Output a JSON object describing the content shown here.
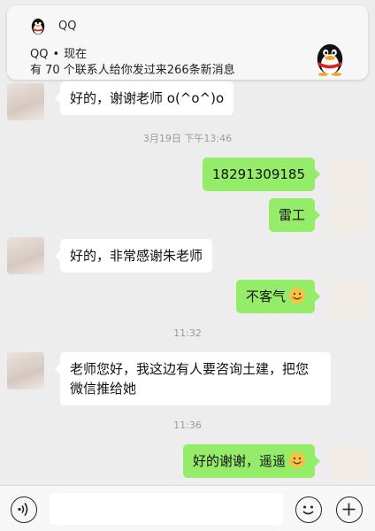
{
  "notification": {
    "app_name": "QQ",
    "sender": "QQ",
    "time": "现在",
    "message": "有 70 个联系人给你发过来266条新消息",
    "icon": "qq-penguin-icon"
  },
  "messages": [
    {
      "side": "in",
      "text": "好的，谢谢老师 o(^o^)o"
    },
    {
      "timestamp": "3月19日 下午13:46"
    },
    {
      "side": "out",
      "text": "18291309185"
    },
    {
      "side": "out",
      "text": "雷工"
    },
    {
      "side": "in",
      "text": "好的，非常感谢朱老师"
    },
    {
      "side": "out",
      "text": "不客气",
      "emoji": "smile-emoji"
    },
    {
      "timestamp": "11:32"
    },
    {
      "side": "in",
      "text": "老师您好，我这边有人要咨询土建，把您微信推给她"
    },
    {
      "timestamp": "11:36"
    },
    {
      "side": "out",
      "text": "好的谢谢，遥遥",
      "emoji": "smile-emoji"
    }
  ],
  "input_bar": {
    "placeholder": "",
    "icons": [
      "voice-icon",
      "emoji-icon",
      "plus-icon"
    ]
  },
  "colors": {
    "background": "#ededed",
    "bubble_out": "#95ec69",
    "bubble_in": "#ffffff",
    "timestamp": "#9b9b9b"
  }
}
